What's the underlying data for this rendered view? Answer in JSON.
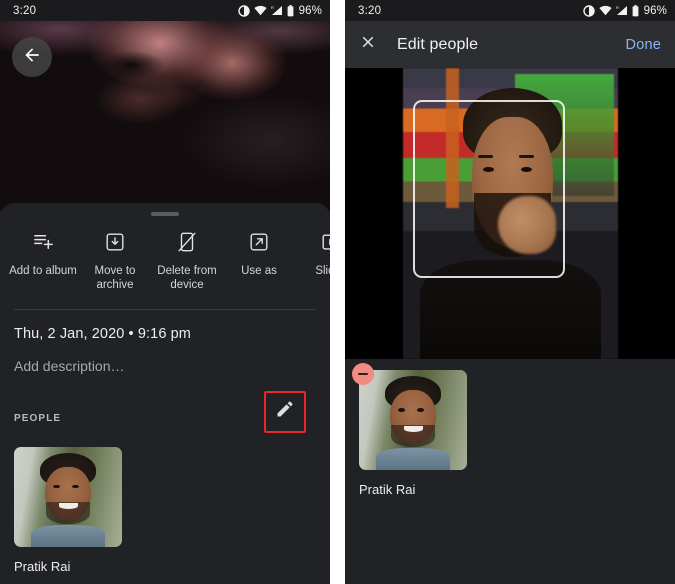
{
  "status_bar": {
    "time": "3:20",
    "battery": "96%",
    "icons": [
      "contrast-icon",
      "wifi-icon",
      "signal-icon",
      "battery-icon"
    ]
  },
  "left_screen": {
    "name": "photo-detail-screen",
    "back_button": {
      "icon": "back-arrow-icon"
    },
    "actions": [
      {
        "label": "Add to album",
        "icon": "add-to-album-icon"
      },
      {
        "label": "Move to archive",
        "icon": "archive-icon"
      },
      {
        "label": "Delete from device",
        "icon": "delete-device-icon"
      },
      {
        "label": "Use as",
        "icon": "open-external-icon"
      },
      {
        "label": "Slides",
        "icon": "slideshow-icon"
      }
    ],
    "meta": {
      "date": "Thu, 2 Jan, 2020  •  9:16 pm",
      "description_placeholder": "Add description…"
    },
    "people": {
      "section_title": "PEOPLE",
      "edit_icon": "pencil-edit-icon",
      "highlight_color": "#e8262b",
      "faces": [
        {
          "name": "Pratik Rai"
        }
      ]
    }
  },
  "right_screen": {
    "name": "edit-people-screen",
    "appbar": {
      "close_icon": "close-icon",
      "title": "Edit people",
      "done_label": "Done",
      "done_color": "#8ab4f8"
    },
    "photo": {
      "face_box_label": "face-detection-box"
    },
    "people": {
      "remove_badge_color": "#f28b82",
      "faces": [
        {
          "name": "Pratik Rai",
          "remove_icon": "remove-minus-icon"
        }
      ]
    }
  }
}
